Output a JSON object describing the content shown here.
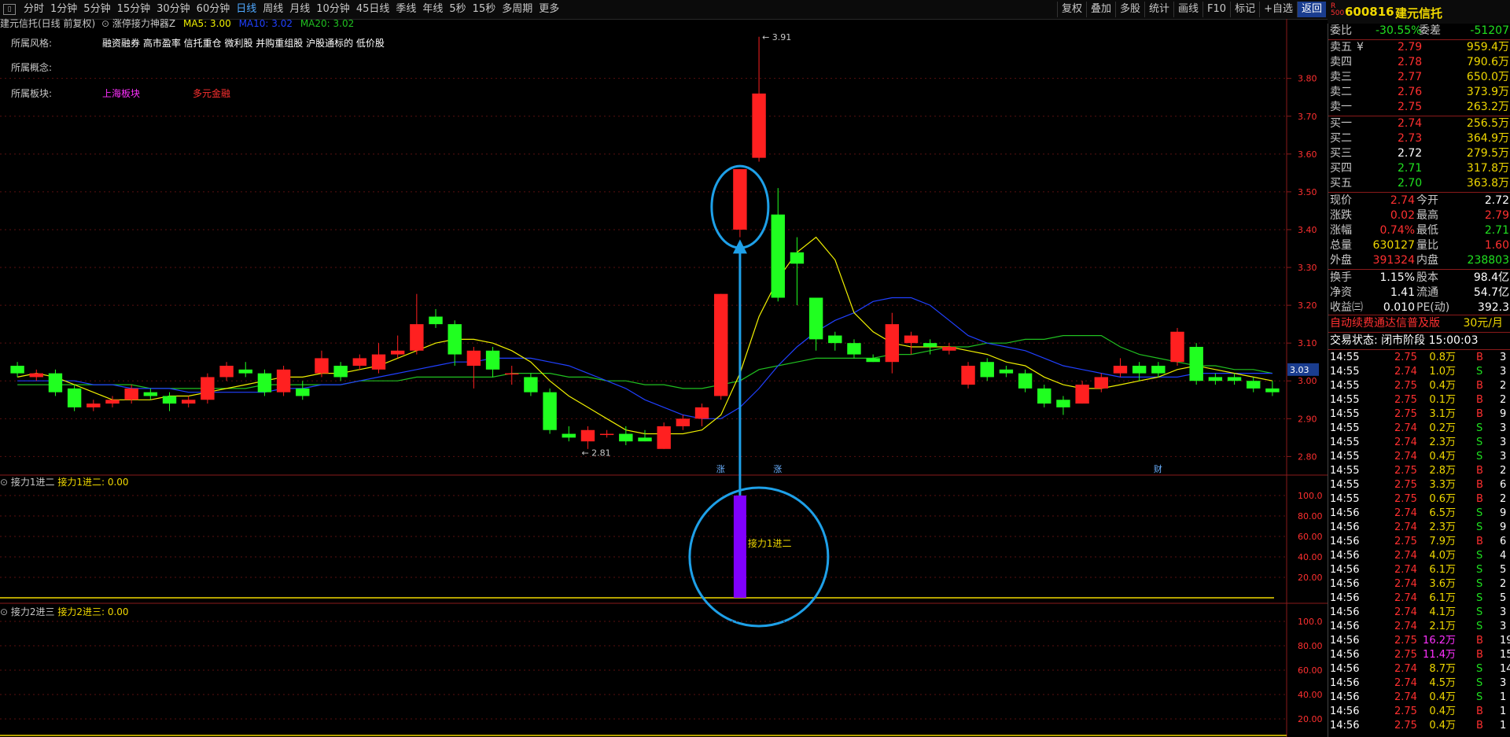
{
  "toolbar": {
    "menu_icon": "menu-icon",
    "period_tabs": [
      "分时",
      "1分钟",
      "5分钟",
      "15分钟",
      "30分钟",
      "60分钟",
      "日线",
      "周线",
      "月线",
      "10分钟",
      "45日线",
      "季线",
      "年线",
      "5秒",
      "15秒",
      "多周期",
      "更多"
    ],
    "active_tab": "日线",
    "right_buttons": [
      "复权",
      "叠加",
      "多股",
      "统计",
      "画线",
      "F10",
      "标记",
      "+自选",
      "返回"
    ],
    "active_button": "返回"
  },
  "stock_header": {
    "badge": "R",
    "badge_sub": "500",
    "code": "600816",
    "name": "建元信托"
  },
  "chart_title": {
    "title": "建元信托(日线 前复权)",
    "indicator": "涨停接力神器Z",
    "ma5": "MA5: 3.00",
    "ma10": "MA10: 3.02",
    "ma20": "MA20: 3.02"
  },
  "info": {
    "style_label": "所属风格:",
    "style_value": "融资融券 高市盈率 信托重仓 微利股 并购重组股 沪股通标的 低价股",
    "concept_label": "所属概念:",
    "sector_label": "所属板块:",
    "sector_1": "上海板块",
    "sector_2": "多元金融"
  },
  "main_chart": {
    "price_ticks": [
      "3.80",
      "3.70",
      "3.60",
      "3.50",
      "3.40",
      "3.30",
      "3.20",
      "3.10",
      "3.00",
      "2.90",
      "2.80"
    ],
    "high_label": "3.91",
    "low_label": "2.81",
    "current_price_tag": "3.03",
    "event_markers": [
      "涨",
      "涨",
      "财"
    ],
    "colors": {
      "up": "#ff2020",
      "down": "#20ff20",
      "ma5": "#f0f000",
      "ma10": "#2040ff",
      "ma20": "#20c020",
      "annotation": "#1ea0e8"
    }
  },
  "chart_data": {
    "type": "candlestick",
    "ylim": [
      2.78,
      3.92
    ],
    "candles": [
      [
        3.04,
        3.02,
        3.05,
        3.01
      ],
      [
        3.01,
        3.02,
        3.03,
        3.0
      ],
      [
        3.02,
        2.97,
        3.03,
        2.96
      ],
      [
        2.98,
        2.93,
        2.99,
        2.92
      ],
      [
        2.93,
        2.94,
        2.95,
        2.92
      ],
      [
        2.94,
        2.95,
        2.96,
        2.93
      ],
      [
        2.95,
        2.98,
        2.99,
        2.94
      ],
      [
        2.97,
        2.96,
        2.98,
        2.95
      ],
      [
        2.96,
        2.94,
        2.97,
        2.92
      ],
      [
        2.94,
        2.95,
        2.96,
        2.93
      ],
      [
        2.95,
        3.01,
        3.02,
        2.94
      ],
      [
        3.01,
        3.04,
        3.05,
        3.0
      ],
      [
        3.03,
        3.02,
        3.05,
        3.01
      ],
      [
        3.02,
        2.97,
        3.03,
        2.96
      ],
      [
        2.97,
        3.03,
        3.04,
        2.96
      ],
      [
        2.98,
        2.96,
        3.0,
        2.95
      ],
      [
        3.02,
        3.06,
        3.08,
        3.01
      ],
      [
        3.04,
        3.01,
        3.05,
        3.0
      ],
      [
        3.04,
        3.06,
        3.07,
        3.03
      ],
      [
        3.03,
        3.07,
        3.1,
        3.02
      ],
      [
        3.07,
        3.08,
        3.12,
        3.06
      ],
      [
        3.08,
        3.15,
        3.23,
        3.07
      ],
      [
        3.17,
        3.15,
        3.19,
        3.14
      ],
      [
        3.15,
        3.07,
        3.16,
        3.04
      ],
      [
        3.04,
        3.08,
        3.09,
        2.98
      ],
      [
        3.08,
        3.03,
        3.09,
        3.01
      ],
      [
        3.02,
        3.02,
        3.04,
        2.99
      ],
      [
        3.01,
        2.97,
        3.02,
        2.96
      ],
      [
        2.97,
        2.87,
        2.98,
        2.86
      ],
      [
        2.86,
        2.85,
        2.88,
        2.84
      ],
      [
        2.84,
        2.87,
        2.88,
        2.82
      ],
      [
        2.86,
        2.86,
        2.87,
        2.85
      ],
      [
        2.86,
        2.84,
        2.88,
        2.83
      ],
      [
        2.85,
        2.84,
        2.87,
        2.84
      ],
      [
        2.82,
        2.88,
        2.89,
        2.82
      ],
      [
        2.88,
        2.9,
        2.91,
        2.87
      ],
      [
        2.9,
        2.93,
        2.94,
        2.88
      ],
      [
        2.96,
        3.23,
        3.23,
        2.95
      ],
      [
        3.4,
        3.56,
        3.56,
        3.38
      ],
      [
        3.59,
        3.76,
        3.91,
        3.58
      ],
      [
        3.44,
        3.22,
        3.51,
        3.21
      ],
      [
        3.34,
        3.31,
        3.38,
        3.2
      ],
      [
        3.22,
        3.11,
        3.22,
        3.08
      ],
      [
        3.12,
        3.1,
        3.13,
        3.08
      ],
      [
        3.1,
        3.07,
        3.11,
        3.06
      ],
      [
        3.06,
        3.05,
        3.07,
        3.05
      ],
      [
        3.05,
        3.15,
        3.18,
        3.02
      ],
      [
        3.1,
        3.12,
        3.13,
        3.07
      ],
      [
        3.1,
        3.09,
        3.11,
        3.07
      ],
      [
        3.08,
        3.09,
        3.1,
        3.07
      ],
      [
        2.99,
        3.04,
        3.05,
        2.98
      ],
      [
        3.05,
        3.01,
        3.06,
        3.0
      ],
      [
        3.03,
        3.02,
        3.04,
        3.01
      ],
      [
        3.02,
        2.98,
        3.03,
        2.97
      ],
      [
        2.98,
        2.94,
        2.99,
        2.93
      ],
      [
        2.95,
        2.93,
        2.96,
        2.91
      ],
      [
        2.94,
        2.99,
        3.0,
        2.94
      ],
      [
        2.98,
        3.01,
        3.02,
        2.97
      ],
      [
        3.02,
        3.04,
        3.06,
        3.01
      ],
      [
        3.04,
        3.02,
        3.05,
        3.0
      ],
      [
        3.04,
        3.02,
        3.05,
        3.01
      ],
      [
        3.05,
        3.13,
        3.14,
        3.04
      ],
      [
        3.09,
        3.0,
        3.1,
        2.99
      ],
      [
        3.01,
        3.0,
        3.02,
        2.99
      ],
      [
        3.01,
        3.0,
        3.02,
        2.99
      ],
      [
        3.0,
        2.98,
        3.01,
        2.97
      ],
      [
        2.98,
        2.97,
        3.0,
        2.96
      ]
    ],
    "ma5": [
      3.01,
      3.02,
      3.01,
      2.99,
      2.97,
      2.95,
      2.95,
      2.95,
      2.96,
      2.96,
      2.97,
      2.98,
      2.99,
      3.0,
      3.01,
      3.01,
      3.02,
      3.02,
      3.03,
      3.04,
      3.06,
      3.08,
      3.1,
      3.11,
      3.11,
      3.1,
      3.08,
      3.05,
      3.0,
      2.96,
      2.93,
      2.9,
      2.87,
      2.86,
      2.86,
      2.86,
      2.87,
      2.91,
      3.02,
      3.17,
      3.27,
      3.34,
      3.38,
      3.32,
      3.18,
      3.13,
      3.1,
      3.09,
      3.09,
      3.09,
      3.08,
      3.07,
      3.05,
      3.04,
      3.01,
      2.99,
      2.98,
      2.98,
      2.99,
      3.0,
      3.01,
      3.03,
      3.04,
      3.03,
      3.02,
      3.01,
      3.0
    ],
    "ma10": [
      3.0,
      3.0,
      3.0,
      3.0,
      2.99,
      2.99,
      2.98,
      2.98,
      2.98,
      2.97,
      2.97,
      2.97,
      2.97,
      2.97,
      2.98,
      2.98,
      2.99,
      2.99,
      3.0,
      3.01,
      3.02,
      3.03,
      3.04,
      3.05,
      3.05,
      3.06,
      3.06,
      3.06,
      3.05,
      3.04,
      3.02,
      3.0,
      2.98,
      2.95,
      2.93,
      2.91,
      2.9,
      2.9,
      2.93,
      2.98,
      3.04,
      3.09,
      3.13,
      3.16,
      3.18,
      3.21,
      3.22,
      3.22,
      3.2,
      3.16,
      3.12,
      3.1,
      3.09,
      3.08,
      3.06,
      3.04,
      3.03,
      3.02,
      3.01,
      3.01,
      3.01,
      3.01,
      3.02,
      3.02,
      3.02,
      3.02,
      3.02
    ],
    "ma20": [
      2.99,
      2.99,
      2.99,
      2.99,
      2.99,
      2.99,
      2.99,
      2.98,
      2.98,
      2.98,
      2.98,
      2.98,
      2.98,
      2.99,
      2.99,
      2.99,
      2.99,
      2.99,
      3.0,
      3.0,
      3.0,
      3.01,
      3.01,
      3.01,
      3.01,
      3.01,
      3.02,
      3.02,
      3.02,
      3.01,
      3.01,
      3.0,
      3.0,
      2.99,
      2.99,
      2.98,
      2.98,
      2.99,
      3.0,
      3.03,
      3.04,
      3.05,
      3.06,
      3.06,
      3.06,
      3.06,
      3.07,
      3.07,
      3.08,
      3.09,
      3.09,
      3.1,
      3.1,
      3.11,
      3.11,
      3.12,
      3.12,
      3.12,
      3.09,
      3.07,
      3.06,
      3.05,
      3.04,
      3.04,
      3.03,
      3.03,
      3.02
    ]
  },
  "panel1": {
    "name": "接力1进二",
    "value_text": "接力1进二: 0.00",
    "bar_label": "接力1进二",
    "ticks": [
      "100.0",
      "80.00",
      "60.00",
      "40.00",
      "20.00"
    ],
    "bar_value": 100,
    "bar_color": "#8000ff"
  },
  "panel2": {
    "name": "接力2进三",
    "value_text": "接力2进三: 0.00",
    "ticks": [
      "100.0",
      "80.00",
      "60.00",
      "40.00",
      "20.00"
    ]
  },
  "quote": {
    "webi_label": "委比",
    "webi_value": "-30.55%",
    "weicha_label": "委差",
    "weicha_value": "-51207",
    "sells": [
      {
        "label": "卖五",
        "flag": "¥",
        "price": "2.79",
        "vol": "959.4万"
      },
      {
        "label": "卖四",
        "flag": "",
        "price": "2.78",
        "vol": "790.6万"
      },
      {
        "label": "卖三",
        "flag": "",
        "price": "2.77",
        "vol": "650.0万"
      },
      {
        "label": "卖二",
        "flag": "",
        "price": "2.76",
        "vol": "373.9万"
      },
      {
        "label": "卖一",
        "flag": "",
        "price": "2.75",
        "vol": "263.2万"
      }
    ],
    "buys": [
      {
        "label": "买一",
        "price": "2.74",
        "vol": "256.5万",
        "color": "red"
      },
      {
        "label": "买二",
        "price": "2.73",
        "vol": "364.9万",
        "color": "red"
      },
      {
        "label": "买三",
        "price": "2.72",
        "vol": "279.5万",
        "color": "white"
      },
      {
        "label": "买四",
        "price": "2.71",
        "vol": "317.8万",
        "color": "green"
      },
      {
        "label": "买五",
        "price": "2.70",
        "vol": "363.8万",
        "color": "green"
      }
    ],
    "stats": [
      {
        "l1": "现价",
        "v1": "2.74",
        "c1": "red",
        "l2": "今开",
        "v2": "2.72",
        "c2": "white"
      },
      {
        "l1": "涨跌",
        "v1": "0.02",
        "c1": "red",
        "l2": "最高",
        "v2": "2.79",
        "c2": "red"
      },
      {
        "l1": "涨幅",
        "v1": "0.74%",
        "c1": "red",
        "l2": "最低",
        "v2": "2.71",
        "c2": "green"
      },
      {
        "l1": "总量",
        "v1": "630127",
        "c1": "yellow",
        "l2": "量比",
        "v2": "1.60",
        "c2": "red"
      },
      {
        "l1": "外盘",
        "v1": "391324",
        "c1": "red",
        "l2": "内盘",
        "v2": "238803",
        "c2": "green"
      }
    ],
    "stats2": [
      {
        "l1": "换手",
        "v1": "1.15%",
        "l2": "股本",
        "v2": "98.4亿"
      },
      {
        "l1": "净资",
        "v1": "1.41",
        "l2": "流通",
        "v2": "54.7亿"
      },
      {
        "l1": "收益㈢",
        "v1": "0.010",
        "l2": "PE(动)",
        "v2": "392.3"
      }
    ],
    "promo_text": "自动续费通达信普及版",
    "promo_price": "30元/月",
    "trade_status": "交易状态: 闭市阶段 15:00:03"
  },
  "ticks": [
    {
      "t": "14:55",
      "p": "2.75",
      "v": "0.8万",
      "bs": "B",
      "n": "3"
    },
    {
      "t": "14:55",
      "p": "2.74",
      "v": "1.0万",
      "bs": "S",
      "n": "3"
    },
    {
      "t": "14:55",
      "p": "2.75",
      "v": "0.4万",
      "bs": "B",
      "n": "2"
    },
    {
      "t": "14:55",
      "p": "2.75",
      "v": "0.1万",
      "bs": "B",
      "n": "2"
    },
    {
      "t": "14:55",
      "p": "2.75",
      "v": "3.1万",
      "bs": "B",
      "n": "9"
    },
    {
      "t": "14:55",
      "p": "2.74",
      "v": "0.2万",
      "bs": "S",
      "n": "3"
    },
    {
      "t": "14:55",
      "p": "2.74",
      "v": "2.3万",
      "bs": "S",
      "n": "3"
    },
    {
      "t": "14:55",
      "p": "2.74",
      "v": "0.4万",
      "bs": "S",
      "n": "3"
    },
    {
      "t": "14:55",
      "p": "2.75",
      "v": "2.8万",
      "bs": "B",
      "n": "2"
    },
    {
      "t": "14:55",
      "p": "2.75",
      "v": "3.3万",
      "bs": "B",
      "n": "6"
    },
    {
      "t": "14:55",
      "p": "2.75",
      "v": "0.6万",
      "bs": "B",
      "n": "2"
    },
    {
      "t": "14:56",
      "p": "2.74",
      "v": "6.5万",
      "bs": "S",
      "n": "9"
    },
    {
      "t": "14:56",
      "p": "2.74",
      "v": "2.3万",
      "bs": "S",
      "n": "9"
    },
    {
      "t": "14:56",
      "p": "2.75",
      "v": "7.9万",
      "bs": "B",
      "n": "6"
    },
    {
      "t": "14:56",
      "p": "2.74",
      "v": "4.0万",
      "bs": "S",
      "n": "4"
    },
    {
      "t": "14:56",
      "p": "2.74",
      "v": "6.1万",
      "bs": "S",
      "n": "5"
    },
    {
      "t": "14:56",
      "p": "2.74",
      "v": "3.6万",
      "bs": "S",
      "n": "2"
    },
    {
      "t": "14:56",
      "p": "2.74",
      "v": "6.1万",
      "bs": "S",
      "n": "5"
    },
    {
      "t": "14:56",
      "p": "2.74",
      "v": "4.1万",
      "bs": "S",
      "n": "3"
    },
    {
      "t": "14:56",
      "p": "2.74",
      "v": "2.1万",
      "bs": "S",
      "n": "3"
    },
    {
      "t": "14:56",
      "p": "2.75",
      "v": "16.2万",
      "bs": "B",
      "n": "19"
    },
    {
      "t": "14:56",
      "p": "2.75",
      "v": "11.4万",
      "bs": "B",
      "n": "15"
    },
    {
      "t": "14:56",
      "p": "2.74",
      "v": "8.7万",
      "bs": "S",
      "n": "14"
    },
    {
      "t": "14:56",
      "p": "2.74",
      "v": "4.5万",
      "bs": "S",
      "n": "3"
    },
    {
      "t": "14:56",
      "p": "2.74",
      "v": "0.4万",
      "bs": "S",
      "n": "1"
    },
    {
      "t": "14:56",
      "p": "2.75",
      "v": "0.4万",
      "bs": "B",
      "n": "1"
    },
    {
      "t": "14:56",
      "p": "2.75",
      "v": "0.4万",
      "bs": "B",
      "n": "1"
    }
  ]
}
